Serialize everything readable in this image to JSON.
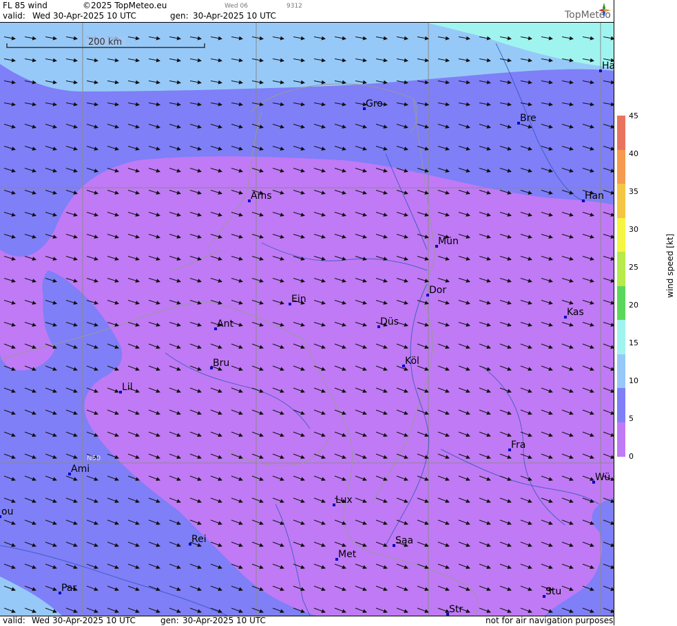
{
  "header": {
    "product": "FL 85 wind",
    "copyright": "©2025 TopMeteo.eu",
    "day_code": "Wed 06",
    "id_code": "9312",
    "valid_label": "valid:",
    "valid_value": "Wed  30-Apr-2025  10 UTC",
    "gen_label": "gen:",
    "gen_value": "30-Apr-2025 10 UTC",
    "brand": "TopMeteo"
  },
  "map": {
    "scale_label": "200 km",
    "lat_label": "N50",
    "cities": [
      {
        "name": "Ha"
      },
      {
        "name": "Gro"
      },
      {
        "name": "Bre"
      },
      {
        "name": "Ams"
      },
      {
        "name": "Han"
      },
      {
        "name": "Mün"
      },
      {
        "name": "Ein"
      },
      {
        "name": "Dor"
      },
      {
        "name": "Ant"
      },
      {
        "name": "Düs"
      },
      {
        "name": "Kas"
      },
      {
        "name": "Bru"
      },
      {
        "name": "Köl"
      },
      {
        "name": "Lil"
      },
      {
        "name": "Fra"
      },
      {
        "name": "Ami"
      },
      {
        "name": "Wü"
      },
      {
        "name": "Lux"
      },
      {
        "name": "ou"
      },
      {
        "name": "Rei"
      },
      {
        "name": "Saa"
      },
      {
        "name": "Met"
      },
      {
        "name": "Par"
      },
      {
        "name": "Stu"
      },
      {
        "name": "Str"
      }
    ]
  },
  "legend": {
    "title": "wind  speed  [kt]",
    "ticks": [
      "45",
      "40",
      "35",
      "30",
      "25",
      "20",
      "15",
      "10",
      "5",
      "0"
    ],
    "colors": [
      "#e8745f",
      "#f59a4f",
      "#f4c644",
      "#f5f542",
      "#b7ea4b",
      "#5bd85b",
      "#a0f4f0",
      "#96c9f8",
      "#7f7ff8",
      "#c07af5"
    ]
  },
  "footer": {
    "valid_label": "valid:",
    "valid_value": "Wed  30-Apr-2025  10 UTC",
    "gen_label": "gen:",
    "gen_value": "30-Apr-2025 10 UTC",
    "note": "not for air navigation purposes"
  }
}
